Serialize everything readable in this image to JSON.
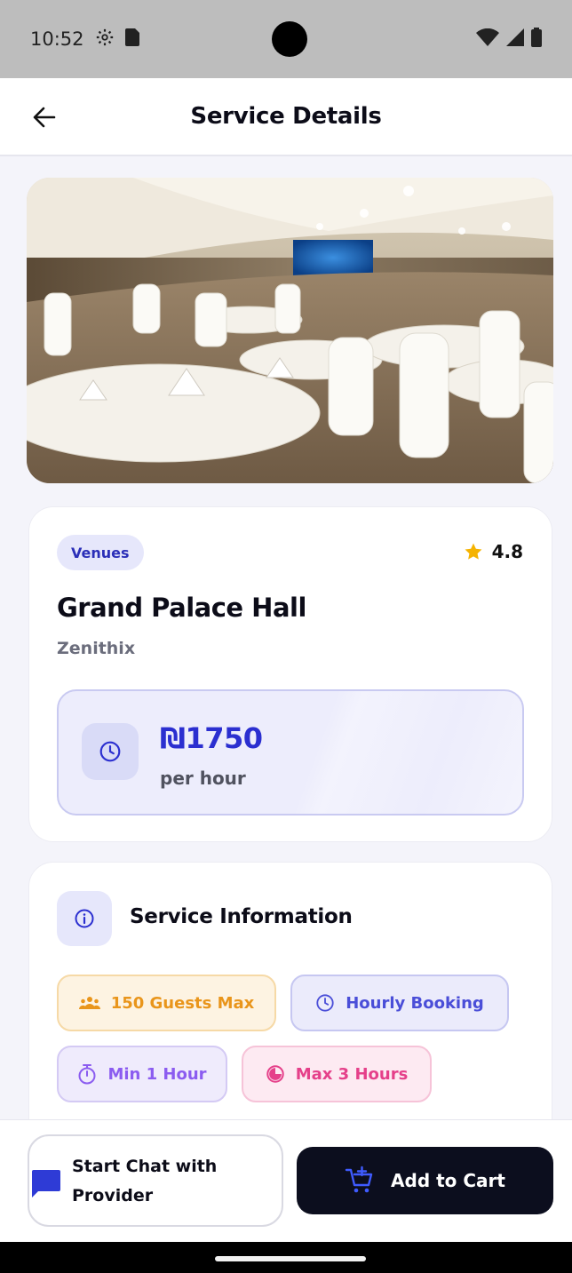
{
  "status_bar": {
    "time": "10:52"
  },
  "app_bar": {
    "title": "Service Details"
  },
  "service": {
    "category": "Venues",
    "rating": "4.8",
    "name": "Grand Palace Hall",
    "provider": "Zenithix",
    "price": "₪1750",
    "price_unit": "per hour"
  },
  "info": {
    "title": "Service Information",
    "tags": {
      "guests": "150 Guests Max",
      "booking": "Hourly Booking",
      "min": "Min 1 Hour",
      "max": "Max 3 Hours"
    }
  },
  "actions": {
    "chat": "Start Chat with Provider",
    "cart": "Add to Cart"
  },
  "colors": {
    "accent": "#2b2fd0",
    "star": "#f5b301",
    "dark_button": "#0c0e1e",
    "guests_tag": "#e9951b",
    "hourly_tag": "#4a4ed8",
    "min_tag": "#8b5cf0",
    "max_tag": "#e5408a"
  },
  "icons": {
    "back": "arrow-left-icon",
    "rating": "star-icon",
    "price": "clock-icon",
    "info": "info-icon",
    "guests": "people-icon",
    "booking": "clock-icon",
    "min": "stopwatch-icon",
    "max": "pie-icon",
    "chat": "chat-bubble-icon",
    "cart": "cart-add-icon"
  }
}
